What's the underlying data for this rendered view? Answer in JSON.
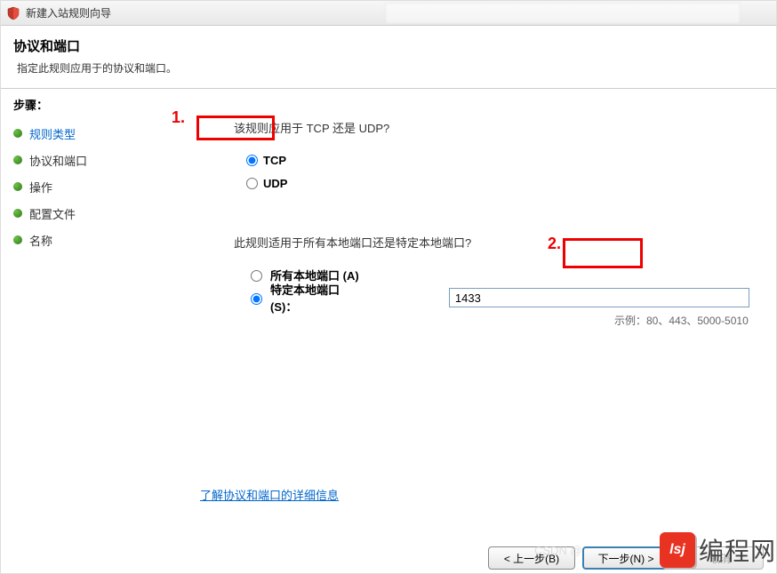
{
  "titlebar": {
    "text": "新建入站规则向导"
  },
  "header": {
    "title": "协议和端口",
    "sub": "指定此规则应用于的协议和端口。"
  },
  "steps": {
    "label": "步骤：",
    "items": [
      {
        "label": "规则类型",
        "active": true
      },
      {
        "label": "协议和端口",
        "active": false
      },
      {
        "label": "操作",
        "active": false
      },
      {
        "label": "配置文件",
        "active": false
      },
      {
        "label": "名称",
        "active": false
      }
    ]
  },
  "q1": {
    "text": "该规则应用于 TCP 还是 UDP?",
    "tcp": "TCP",
    "udp": "UDP"
  },
  "q2": {
    "text": "此规则适用于所有本地端口还是特定本地端口?",
    "all": "所有本地端口 (A)",
    "specific": "特定本地端口 (S)：",
    "value": "1433",
    "example": "示例：80、443、5000-5010"
  },
  "learnmore": "了解协议和端口的详细信息",
  "footer": {
    "back": "< 上一步(B)",
    "next": "下一步(N) >",
    "cancel": "取消"
  },
  "annotations": {
    "one": "1.",
    "two": "2."
  },
  "watermark": {
    "icon": "lsj",
    "text": "编程网"
  }
}
